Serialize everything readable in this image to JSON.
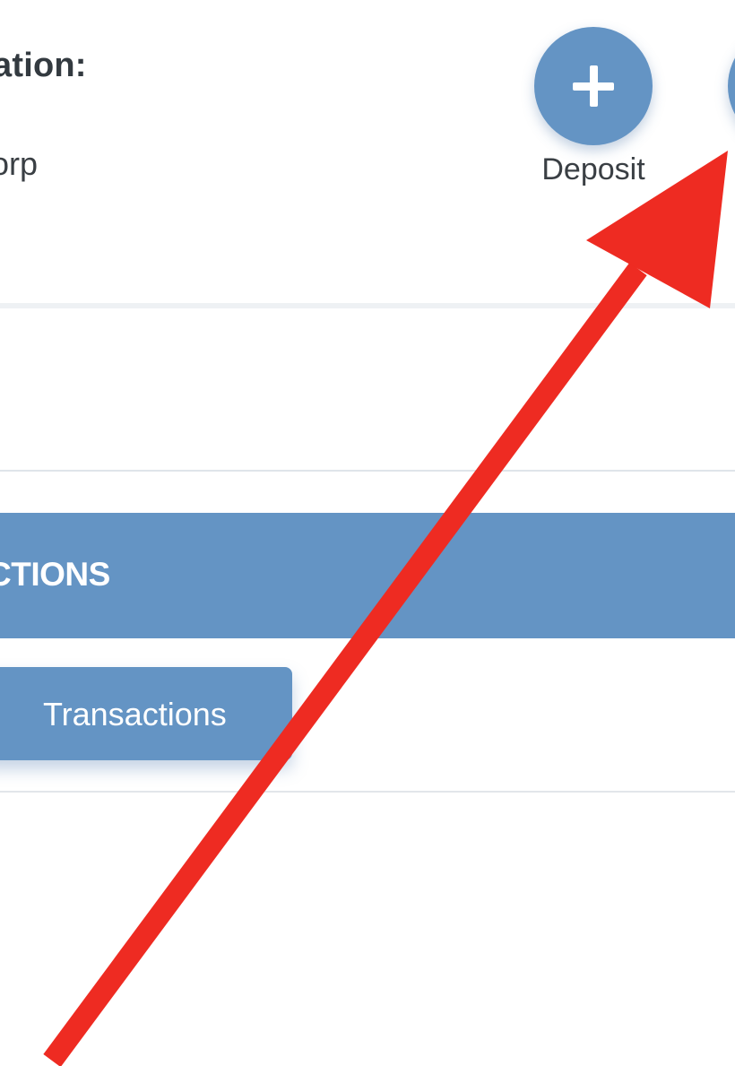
{
  "header": {
    "info_label": "ation:",
    "info_value": "orp"
  },
  "actions": {
    "deposit_icon": "plus-icon",
    "deposit_label": "Deposit"
  },
  "section": {
    "title": "CTIONS"
  },
  "tabs": {
    "transactions_label": "Transactions"
  },
  "annotation": {
    "arrow_color": "#ee2b22"
  },
  "colors": {
    "accent": "#6494c4"
  }
}
